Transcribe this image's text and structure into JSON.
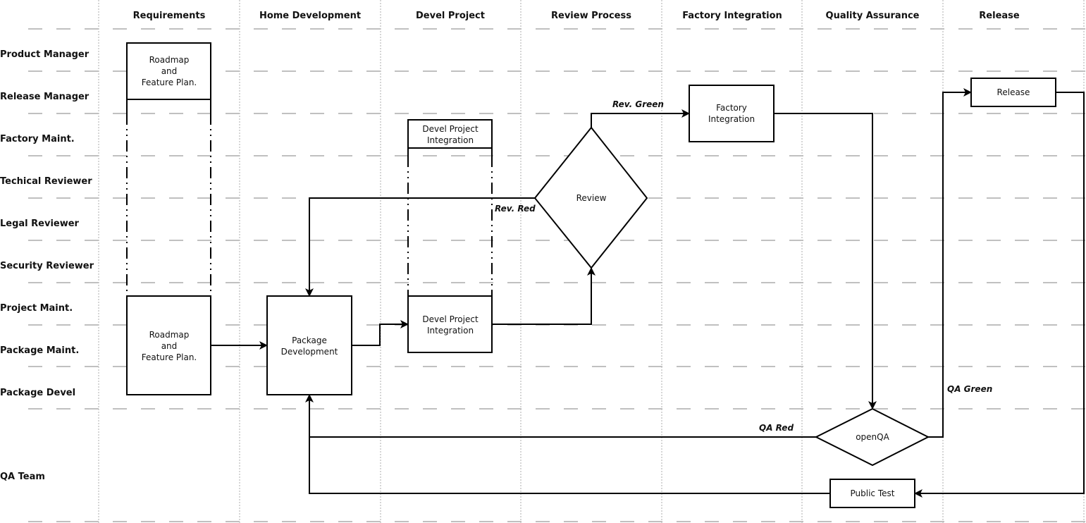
{
  "columns": [
    "Requirements",
    "Home Development",
    "Devel Project",
    "Review Process",
    "Factory Integration",
    "Quality Assurance",
    "Release"
  ],
  "lanes": [
    "Product Manager",
    "Release Manager",
    "Factory Maint.",
    "Techical Reviewer",
    "Legal Reviewer",
    "Security Reviewer",
    "Project Maint.",
    "Package Maint.",
    "Package Devel",
    "QA Team"
  ],
  "nodes": {
    "roadmap_top": [
      "Roadmap",
      "and",
      "Feature Plan."
    ],
    "roadmap_bottom": [
      "Roadmap",
      "and",
      "Feature Plan."
    ],
    "package_development": [
      "Package",
      "Development"
    ],
    "devel_project_top": [
      "Devel Project",
      "Integration"
    ],
    "devel_project_bottom": [
      "Devel Project",
      "Integration"
    ],
    "review": [
      "Review"
    ],
    "factory_integration": [
      "Factory",
      "Integration"
    ],
    "release": [
      "Release"
    ],
    "openqa": [
      "openQA"
    ],
    "public_test": [
      "Public Test"
    ]
  },
  "edge_labels": {
    "rev_green": "Rev. Green",
    "rev_red": "Rev. Red",
    "qa_red": "QA Red",
    "qa_green": "QA Green"
  }
}
